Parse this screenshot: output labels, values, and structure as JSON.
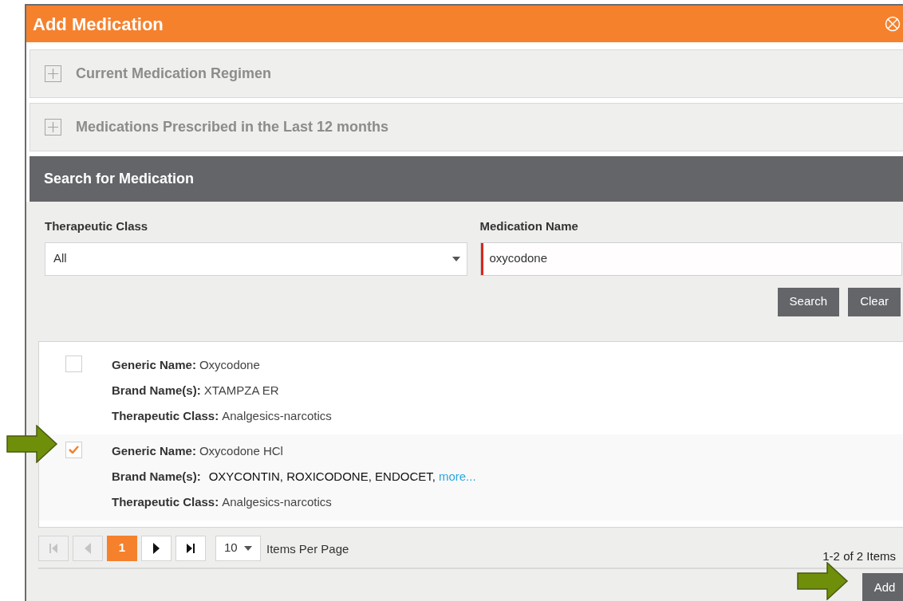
{
  "dialog": {
    "title": "Add Medication"
  },
  "sections": [
    {
      "title": "Current Medication Regimen",
      "expanded": false
    },
    {
      "title": "Medications Prescribed in the Last 12 months",
      "expanded": false
    }
  ],
  "search": {
    "title": "Search for Medication",
    "fields": [
      {
        "kind": "select",
        "label": "Therapeutic Class",
        "value": "All",
        "focused": false
      },
      {
        "kind": "text",
        "label": "Medication Name",
        "value": "oxycodone",
        "focused": true
      }
    ],
    "buttons": [
      "Search",
      "Clear"
    ]
  },
  "results": [
    {
      "checked": false,
      "lines": [
        {
          "label": "Generic Name:",
          "value": "Oxycodone"
        },
        {
          "label": "Brand Name(s):",
          "value": "XTAMPZA ER"
        },
        {
          "label": "Therapeutic Class:",
          "value": "Analgesics-narcotics"
        }
      ]
    },
    {
      "checked": true,
      "lines": [
        {
          "label": "Generic Name:",
          "value": "Oxycodone HCl"
        },
        {
          "label": "Brand Name(s):",
          "value": "OXYCONTIN, ROXICODONE, ENDOCET,",
          "link": "more..."
        },
        {
          "label": "Therapeutic Class:",
          "value": "Analgesics-narcotics"
        }
      ]
    }
  ],
  "pager": {
    "buttons": [
      {
        "kind": "first",
        "disabled": true
      },
      {
        "kind": "prev",
        "disabled": true
      },
      {
        "kind": "page",
        "label": "1",
        "selected": true
      },
      {
        "kind": "next",
        "disabled": false
      },
      {
        "kind": "last",
        "disabled": false
      }
    ],
    "page_size": "10",
    "page_size_label": "Items Per Page",
    "summary": "1-2 of 2 Items"
  },
  "footer": {
    "buttons": [
      "Add"
    ]
  }
}
